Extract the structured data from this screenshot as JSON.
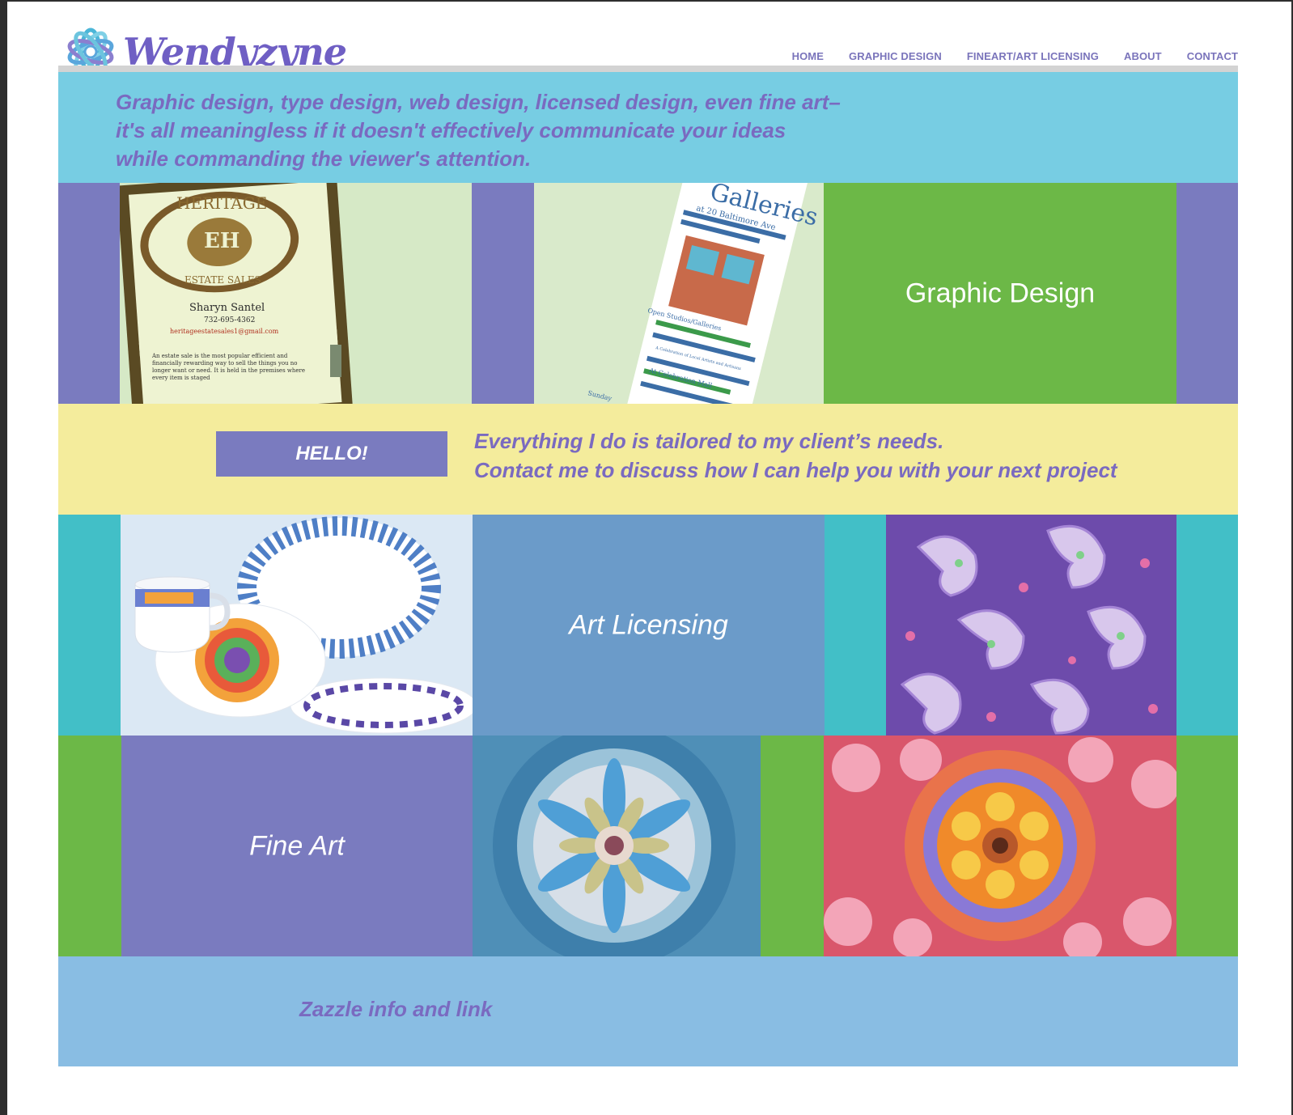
{
  "brand": {
    "name": "Wendyzyne",
    "logo_icon": "swirl-flower-icon",
    "colors": {
      "purple": "#7a7bbf",
      "cyan": "#77cde3",
      "green": "#6cb847",
      "yellow": "#f4ec9c",
      "blue": "#89bde3",
      "teal": "#42bfc7"
    }
  },
  "nav": {
    "items": [
      {
        "label": "HOME"
      },
      {
        "label": "GRAPHIC DESIGN"
      },
      {
        "label": "FINEART/ART LICENSING"
      },
      {
        "label": "ABOUT"
      },
      {
        "label": "CONTACT"
      }
    ]
  },
  "intro": {
    "lines": [
      "Graphic design, type design, web design, licensed design, even fine art–",
      " it's all meaningless if it doesn't effectively communicate your ideas",
      "while commanding the viewer's attention."
    ]
  },
  "row1": {
    "card": {
      "heading": "HERITAGE",
      "monogram": "EH",
      "subheading": "ESTATE SALES",
      "name": "Sharyn Santel",
      "phone": "732-695-4362",
      "email": "heritageestatesales1@gmail.com",
      "body": "An estate sale is the most popular efficient and financially rewarding way to sell the things you no longer want or need. It is held in the premises where every item is staged"
    },
    "flyer": {
      "title": "Galleries",
      "subtitle": "at 20 Baltimore Ave",
      "line1": "Open Studios/Galleries",
      "line2": "A Celebration of Local Artists and Artisans",
      "line3": "At Celebration Mall",
      "line4": "Sunday"
    },
    "tile_label": "Graphic Design"
  },
  "hello": {
    "button_label": "HELLO!",
    "lines": [
      "Everything I do is tailored to my client’s needs.",
      "Contact me to discuss how I can help you with your next project"
    ]
  },
  "row3": {
    "tile_label": "Art Licensing"
  },
  "row4": {
    "tile_label": "Fine Art"
  },
  "footer": {
    "link_label": "Zazzle info and link"
  }
}
